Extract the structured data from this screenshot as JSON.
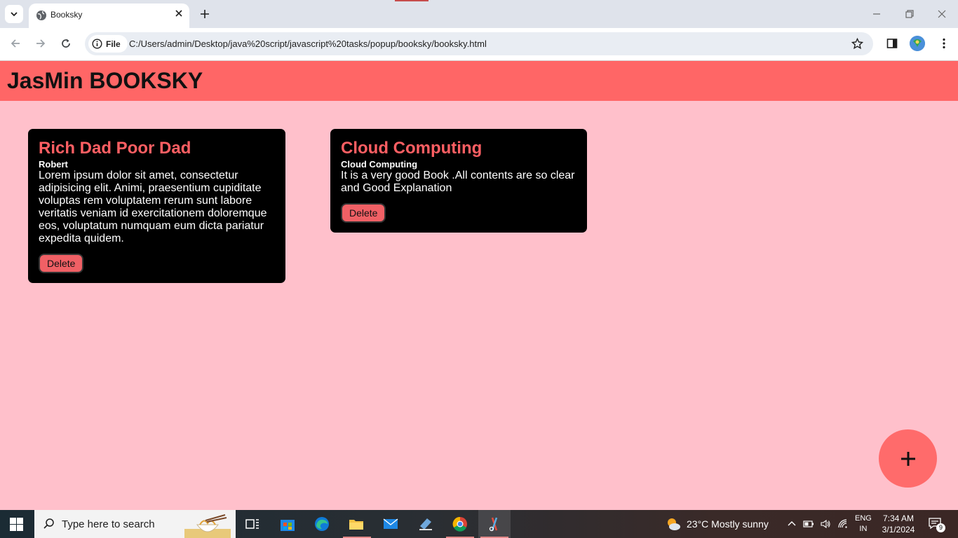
{
  "browser": {
    "tab_title": "Booksky",
    "chip_label": "File",
    "url": "C:/Users/admin/Desktop/java%20script/javascript%20tasks/popup/booksky/booksky.html"
  },
  "page": {
    "site_title": "JasMin BOOKSKY",
    "books": [
      {
        "title": "Rich Dad Poor Dad",
        "author": "Robert",
        "description": "Lorem ipsum dolor sit amet, consectetur adipisicing elit. Animi, praesentium cupiditate voluptas rem voluptatem rerum sunt labore veritatis veniam id exercitationem doloremque eos, voluptatum numquam eum dicta pariatur expedita quidem.",
        "delete_label": "Delete"
      },
      {
        "title": "Cloud Computing",
        "author": "Cloud Computing",
        "description": "It is a very good Book .All contents are so clear and Good Explanation",
        "delete_label": "Delete"
      }
    ],
    "fab_icon": "plus-icon"
  },
  "taskbar": {
    "search_placeholder": "Type here to search",
    "weather": "23°C  Mostly sunny",
    "lang_top": "ENG",
    "lang_bottom": "IN",
    "time": "7:34 AM",
    "date": "3/1/2024",
    "notification_count": "9"
  },
  "colors": {
    "page_bg": "#ffc0cb",
    "header_bg": "#ff6666",
    "card_bg": "#000000",
    "card_title": "#ff5f63",
    "delete_bg": "#f06065",
    "fab_bg": "#ff6b6b"
  }
}
